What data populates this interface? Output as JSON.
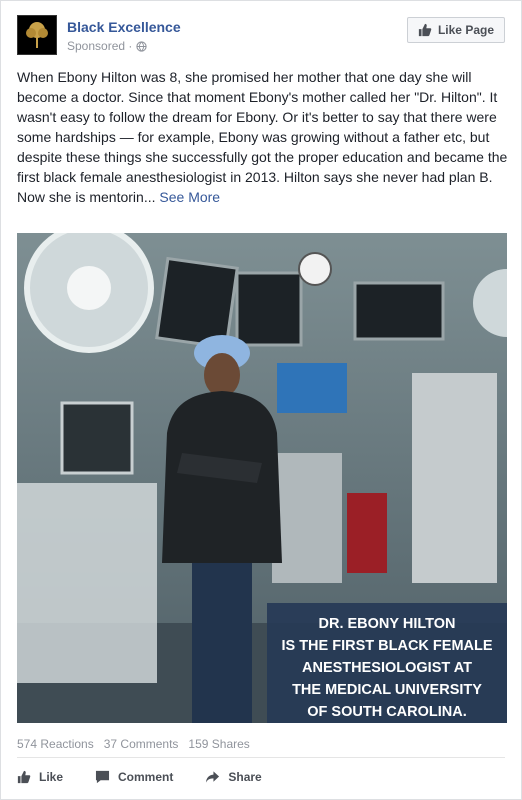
{
  "post": {
    "page_name": "Black Excellence",
    "sponsored_label": "Sponsored ·",
    "like_page_label": "Like Page",
    "text_paragraph": "When Ebony Hilton was 8, she promised her mother that one day she will become a doctor. Since that moment Ebony's mother called her \"Dr. Hilton\". It wasn't easy to follow the dream for Ebony. Or it's better to say that there were some hardships — for example, Ebony was growing without a father etc, but despite these things she successfully got the proper education and became the first black female anesthesiologist in 2013. Hilton says she never had plan B.",
    "text_truncated": "Now she is mentorin... ",
    "see_more_label": "See More",
    "image_caption_lines": [
      "DR. EBONY HILTON",
      "IS THE FIRST BLACK FEMALE",
      "ANESTHESIOLOGIST AT",
      "THE MEDICAL UNIVERSITY",
      "OF SOUTH CAROLINA."
    ]
  },
  "stats": {
    "reactions": "574 Reactions",
    "comments": "37 Comments",
    "shares": "159 Shares"
  },
  "actions": {
    "like": "Like",
    "comment": "Comment",
    "share": "Share"
  },
  "colors": {
    "link": "#365899",
    "meta": "#90949c",
    "caption_bg": "#263a56"
  }
}
